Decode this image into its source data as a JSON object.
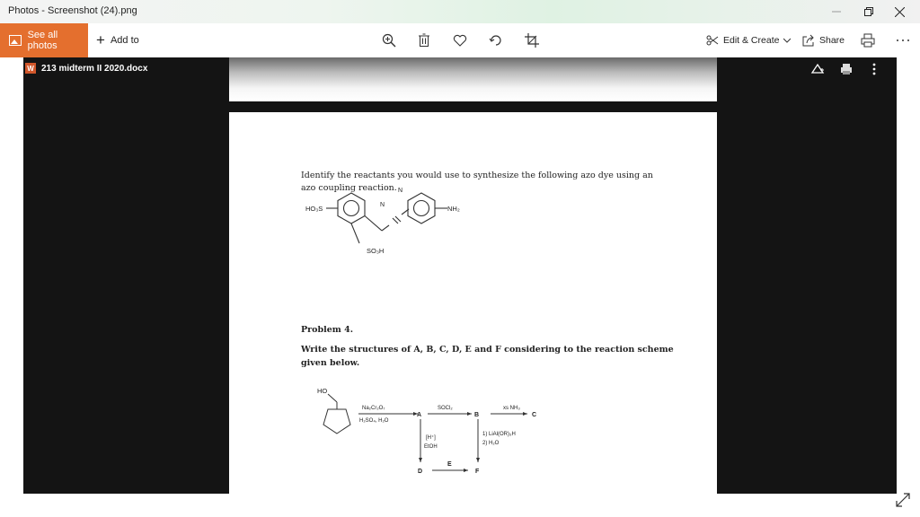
{
  "window": {
    "title": "Photos - Screenshot (24).png"
  },
  "commandbar": {
    "see_all": "See all photos",
    "add_to": "Add to",
    "edit_create": "Edit & Create",
    "share": "Share"
  },
  "viewer": {
    "doc_name": "213 midterm II 2020.docx",
    "doc_badge": "W"
  },
  "document": {
    "q_line1": "Identify the reactants you would use to synthesize the following azo dye using an",
    "q_line2": "azo coupling reaction.",
    "dye_labels": {
      "so3h_left": "HO₃S",
      "nh2": "NH₂",
      "n_top": "N",
      "n_bottom": "N",
      "so3h_bottom": "SO₃H"
    },
    "problem_title": "Problem 4.",
    "p_line1": "Write the structures of A, B, C, D, E and F considering to the reaction scheme",
    "p_line2": "given below.",
    "scheme": {
      "ho": "HO",
      "reagent1_top": "Na₂Cr₂O₇",
      "reagent1_bottom": "H₂SO₄, H₂O",
      "A": "A",
      "reagent2": "SOCl₂",
      "B": "B",
      "reagent3": "xs NH₃",
      "C": "C",
      "reagent4_top": "[H⁺]",
      "reagent4_bottom": "EtOH",
      "reagent5_top": "1) LiAl(OR)₃H",
      "reagent5_bottom": "2) H₂O",
      "D": "D",
      "E": "E",
      "F": "F"
    }
  }
}
